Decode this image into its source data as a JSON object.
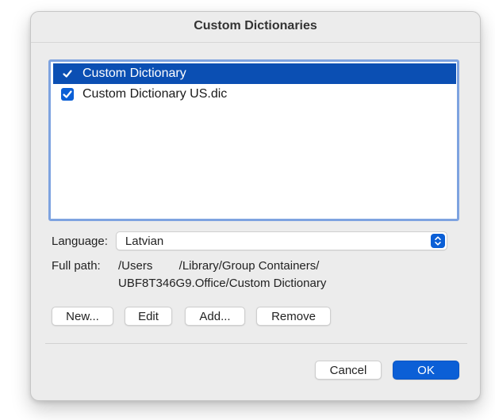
{
  "dialog": {
    "title": "Custom Dictionaries"
  },
  "dictionaries": [
    {
      "label": "Custom Dictionary",
      "checked": true,
      "selected": true
    },
    {
      "label": "Custom Dictionary US.dic",
      "checked": true,
      "selected": false
    }
  ],
  "language": {
    "label": "Language:",
    "value": "Latvian"
  },
  "full_path": {
    "label": "Full path:",
    "line1": "/Users        /Library/Group Containers/",
    "line2": "UBF8T346G9.Office/Custom Dictionary"
  },
  "buttons": {
    "new": "New...",
    "edit": "Edit",
    "add": "Add...",
    "remove": "Remove",
    "cancel": "Cancel",
    "ok": "OK"
  },
  "colors": {
    "accent": "#0b5fd6",
    "selection": "#0b4fb3",
    "list_focus_ring": "#7ea3e0",
    "dialog_bg": "#ececec"
  },
  "icons": {
    "checkbox": "checkmark-icon",
    "select_stepper": "chevron-up-down-icon"
  }
}
